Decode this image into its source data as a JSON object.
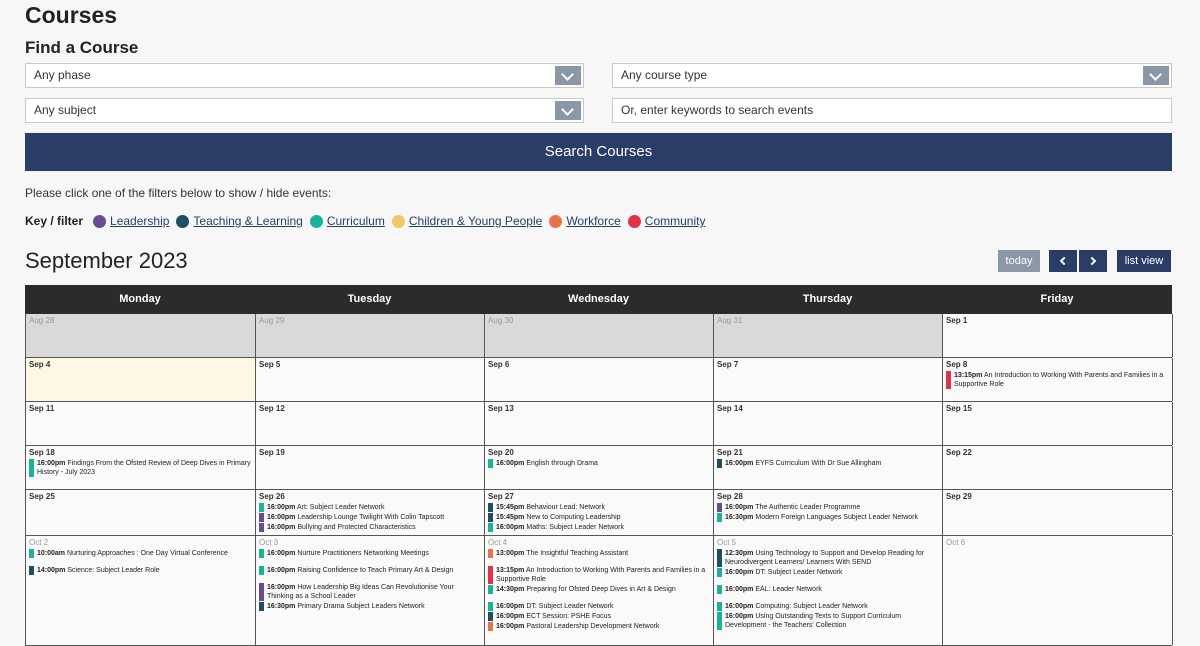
{
  "page_title": "Courses",
  "find_title": "Find a Course",
  "filters": {
    "phase": "Any phase",
    "course_type": "Any course type",
    "subject": "Any subject",
    "search_placeholder": "Or, enter keywords to search events"
  },
  "search_button": "Search Courses",
  "filter_hint": "Please click one of the filters below to show / hide events:",
  "key": {
    "label": "Key / filter",
    "items": [
      {
        "label": "Leadership",
        "color": "#6a4c93"
      },
      {
        "label": "Teaching & Learning",
        "color": "#1f4e63"
      },
      {
        "label": "Curriculum",
        "color": "#1ab39a"
      },
      {
        "label": "Children & Young People",
        "color": "#f2c66d"
      },
      {
        "label": "Workforce",
        "color": "#e8734a"
      },
      {
        "label": "Community",
        "color": "#e0334a"
      }
    ]
  },
  "calendar": {
    "month": "September 2023",
    "today_btn": "today",
    "list_btn": "list view",
    "weekdays": [
      "Monday",
      "Tuesday",
      "Wednesday",
      "Thursday",
      "Friday"
    ],
    "weeks": [
      {
        "height": 44,
        "days": [
          {
            "label": "Aug 28",
            "other": true,
            "events": []
          },
          {
            "label": "Aug 29",
            "other": true,
            "events": []
          },
          {
            "label": "Aug 30",
            "other": true,
            "events": []
          },
          {
            "label": "Aug 31",
            "other": true,
            "events": []
          },
          {
            "label": "Sep 1",
            "events": []
          }
        ]
      },
      {
        "height": 44,
        "days": [
          {
            "label": "Sep 4",
            "today": true,
            "events": []
          },
          {
            "label": "Sep 5",
            "events": []
          },
          {
            "label": "Sep 6",
            "events": []
          },
          {
            "label": "Sep 7",
            "events": []
          },
          {
            "label": "Sep 8",
            "events": [
              {
                "time": "13:15pm",
                "title": "An Introduction to Working With Parents and Families in a Supportive Role",
                "color": "#e0334a"
              }
            ]
          }
        ]
      },
      {
        "height": 44,
        "days": [
          {
            "label": "Sep 11",
            "events": []
          },
          {
            "label": "Sep 12",
            "events": []
          },
          {
            "label": "Sep 13",
            "events": []
          },
          {
            "label": "Sep 14",
            "events": []
          },
          {
            "label": "Sep 15",
            "events": []
          }
        ]
      },
      {
        "height": 44,
        "days": [
          {
            "label": "Sep 18",
            "events": [
              {
                "time": "16:00pm",
                "title": "Findings From the Ofsted Review of Deep Dives in Primary History - July 2023",
                "color": "#1ab39a"
              }
            ]
          },
          {
            "label": "Sep 19",
            "events": []
          },
          {
            "label": "Sep 20",
            "events": [
              {
                "time": "16:00pm",
                "title": "English through Drama",
                "color": "#1ab39a"
              }
            ]
          },
          {
            "label": "Sep 21",
            "events": [
              {
                "time": "16:00pm",
                "title": "EYFS Curriculum With Dr Sue Allingham",
                "color": "#1f4e63"
              }
            ]
          },
          {
            "label": "Sep 22",
            "events": []
          }
        ]
      },
      {
        "height": 46,
        "days": [
          {
            "label": "Sep 25",
            "events": []
          },
          {
            "label": "Sep 26",
            "events": [
              {
                "time": "16:00pm",
                "title": "Art: Subject Leader Network",
                "color": "#1ab39a"
              },
              {
                "time": "16:00pm",
                "title": "Leadership Lounge Twilight With Colin Tapscott",
                "color": "#6a4c93"
              },
              {
                "time": "16:00pm",
                "title": "Bullying and Protected Characteristics",
                "color": "#6a4c93"
              }
            ]
          },
          {
            "label": "Sep 27",
            "events": [
              {
                "time": "15:45pm",
                "title": "Behaviour Lead: Network",
                "color": "#1f4e63"
              },
              {
                "time": "15:45pm",
                "title": "New to Computing Leadership",
                "color": "#1f4e63"
              },
              {
                "time": "16:00pm",
                "title": "Maths: Subject Leader Network",
                "color": "#1ab39a"
              }
            ]
          },
          {
            "label": "Sep 28",
            "events": [
              {
                "time": "16:00pm",
                "title": "The Authentic Leader Programme",
                "color": "#6a4c93"
              },
              {
                "time": "16:30pm",
                "title": "Modern Foreign Languages Subject Leader Network",
                "color": "#1ab39a"
              }
            ]
          },
          {
            "label": "Sep 29",
            "events": []
          }
        ]
      },
      {
        "height": 110,
        "days": [
          {
            "label": "Oct 2",
            "other": true,
            "light": true,
            "events": [
              {
                "time": "10:00am",
                "title": "Nurturing Approaches : One Day Virtual Conference",
                "color": "#1ab39a"
              },
              {
                "time": "14:00pm",
                "title": "Science: Subject Leader Role",
                "color": "#1f4e63",
                "gap": 8
              }
            ]
          },
          {
            "label": "Oct 3",
            "other": true,
            "light": true,
            "events": [
              {
                "time": "16:00pm",
                "title": "Nurture Practitioners Networking Meetings",
                "color": "#1ab39a"
              },
              {
                "time": "16:00pm",
                "title": "Raising Confidence to Teach Primary Art & Design",
                "color": "#1ab39a",
                "gap": 8
              },
              {
                "time": "16:00pm",
                "title": "How Leadership Big Ideas Can Revolutionise Your Thinking as a School Leader",
                "color": "#6a4c93",
                "gap": 8
              },
              {
                "time": "16:30pm",
                "title": "Primary Drama Subject Leaders Network",
                "color": "#1f4e63"
              }
            ]
          },
          {
            "label": "Oct 4",
            "other": true,
            "light": true,
            "events": [
              {
                "time": "13:00pm",
                "title": "The Insightful Teaching Assistant",
                "color": "#e8734a"
              },
              {
                "time": "13:15pm",
                "title": "An Introduction to Working With Parents and Families in a Supportive Role",
                "color": "#e0334a",
                "gap": 8
              },
              {
                "time": "14:30pm",
                "title": "Preparing for Ofsted Deep Dives in Art & Design",
                "color": "#1ab39a"
              },
              {
                "time": "16:00pm",
                "title": "DT: Subject Leader Network",
                "color": "#1ab39a",
                "gap": 8
              },
              {
                "time": "16:00pm",
                "title": "ECT Session: PSHE Focus",
                "color": "#1f4e63"
              },
              {
                "time": "16:00pm",
                "title": "Pastoral Leadership Development Network",
                "color": "#e8734a"
              }
            ]
          },
          {
            "label": "Oct 5",
            "other": true,
            "light": true,
            "events": [
              {
                "time": "12:30pm",
                "title": "Using Technology to Support and Develop Reading for Neurodivergent Learners/ Learners With SEND",
                "color": "#1f4e63"
              },
              {
                "time": "16:00pm",
                "title": "DT: Subject Leader Network",
                "color": "#1ab39a"
              },
              {
                "time": "16:00pm",
                "title": "EAL: Leader Network",
                "color": "#1ab39a",
                "gap": 8
              },
              {
                "time": "16:00pm",
                "title": "Computing: Subject Leader Network",
                "color": "#1ab39a",
                "gap": 8
              },
              {
                "time": "16:00pm",
                "title": "Using Outstanding Texts to Support Curriculum Development - the Teachers' Collection",
                "color": "#1ab39a"
              }
            ]
          },
          {
            "label": "Oct 6",
            "other": true,
            "light": true,
            "events": []
          }
        ]
      }
    ]
  }
}
